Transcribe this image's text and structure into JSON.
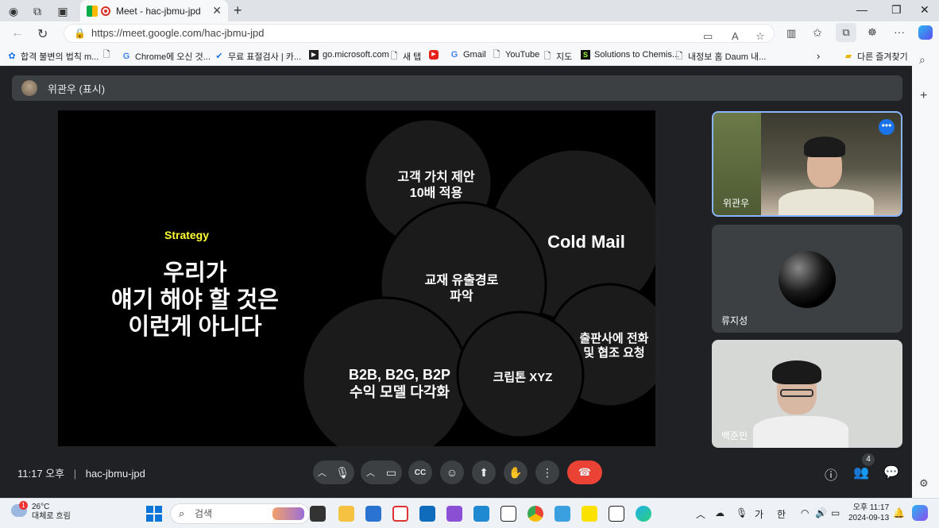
{
  "browser": {
    "tab_title": "Meet - hac-jbmu-jpd",
    "url": "https://meet.google.com/hac-jbmu-jpd",
    "bookmarks": [
      "합격 불변의 법칙 m...",
      "",
      "Chrome에 오신 것...",
      "무료 표절검사 | 카...",
      "go.microsoft.com",
      "새 탭",
      "",
      "Gmail",
      "YouTube",
      "지도",
      "Solutions to Chemis...",
      "내정보 홈 Daum 내..."
    ],
    "other_favorites": "다른 즐겨찾기"
  },
  "meet": {
    "presenter_label": "위관우 (표시)",
    "time": "11:17 오후",
    "separator": "|",
    "meeting_code": "hac-jbmu-jpd",
    "participant_count": "4",
    "participants": [
      {
        "name": "위관우"
      },
      {
        "name": "류지성"
      },
      {
        "name": "백준민"
      }
    ],
    "more_options": "•••"
  },
  "slide": {
    "strategy": "Strategy",
    "headline_lines": [
      "우리가",
      "얘기 해야 할 것은",
      "이런게 아니다"
    ],
    "circles": [
      {
        "lines": [
          "고객 가치 제안",
          "10배 적용"
        ]
      },
      {
        "lines": [
          "Cold Mail"
        ]
      },
      {
        "lines": [
          "교재 유출경로",
          "파악"
        ]
      },
      {
        "lines": [
          "B2B, B2G, B2P",
          "수익 모델 다각화"
        ]
      },
      {
        "lines": [
          "크립톤 XYZ"
        ]
      },
      {
        "lines": [
          "출판사에 전화",
          "및 협조 요청"
        ]
      }
    ],
    "accent_color": "#ffff33"
  },
  "taskbar": {
    "temp": "26°C",
    "weather": "대체로 흐림",
    "search_placeholder": "검색",
    "ime_lang": "가",
    "ime_mode": "한",
    "time": "오후 11:17",
    "date": "2024-09-13"
  },
  "colors": {
    "meet_bg": "#202124",
    "end_call": "#ea4335",
    "active_border": "#8ab4f8"
  }
}
